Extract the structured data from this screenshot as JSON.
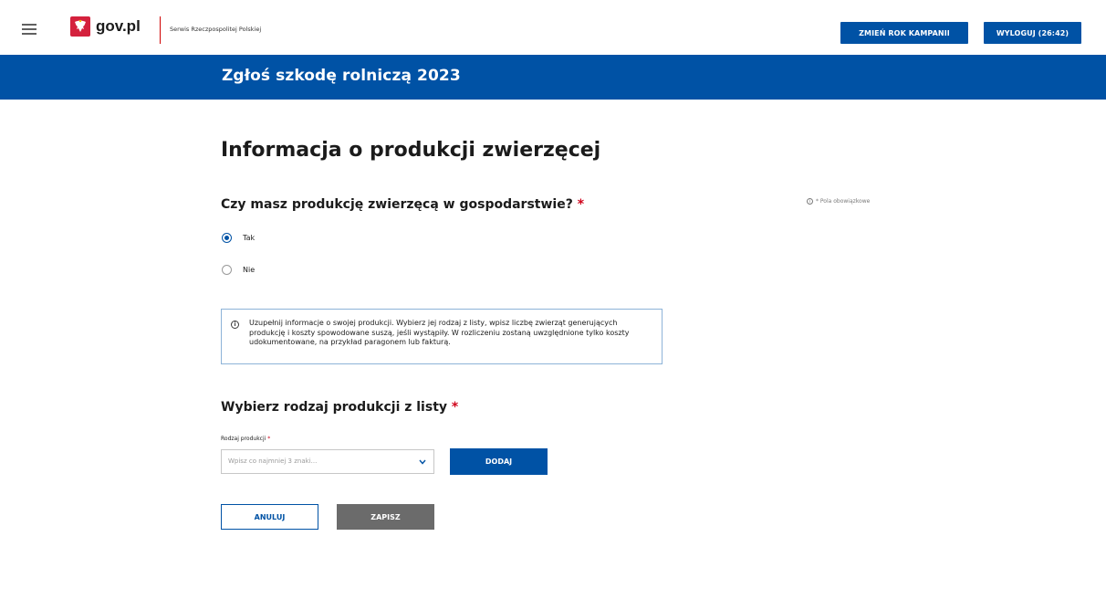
{
  "header": {
    "brand": "gov.pl",
    "service_name": "Serwis Rzeczpospolitej Polskiej",
    "change_year_label": "ZMIEŃ ROK KAMPANII",
    "logout_label": "WYLOGUJ (26:42)",
    "menu_icon": "hamburger-icon",
    "emblem_icon": "polish-eagle-emblem",
    "accent_color": "#0052a5"
  },
  "banner": {
    "title": "Zgłoś szkodę rolniczą 2023"
  },
  "main": {
    "page_title": "Informacja o produkcji zwierzęcej",
    "question": "Czy masz produkcję zwierzęcą w gospodarstwie?",
    "required_marker": "*",
    "required_note": "* Pola obowiązkowe",
    "options": [
      {
        "label": "Tak",
        "selected": true
      },
      {
        "label": "Nie",
        "selected": false
      }
    ],
    "info_text": "Uzupełnij informacje o swojej produkcji. Wybierz jej rodzaj z listy, wpisz liczbę zwierząt generujących produkcję i koszty spowodowane suszą, jeśli wystąpiły. W rozliczeniu zostaną uwzględnione tylko koszty udokumentowane, na przykład paragonem lub fakturą.",
    "section_title": "Wybierz rodzaj produkcji z listy",
    "field_label": "Rodzaj produkcji",
    "field_placeholder": "Wpisz co najmniej 3 znaki...",
    "add_label": "DODAJ",
    "cancel_label": "ANULUJ",
    "save_label": "ZAPISZ"
  }
}
